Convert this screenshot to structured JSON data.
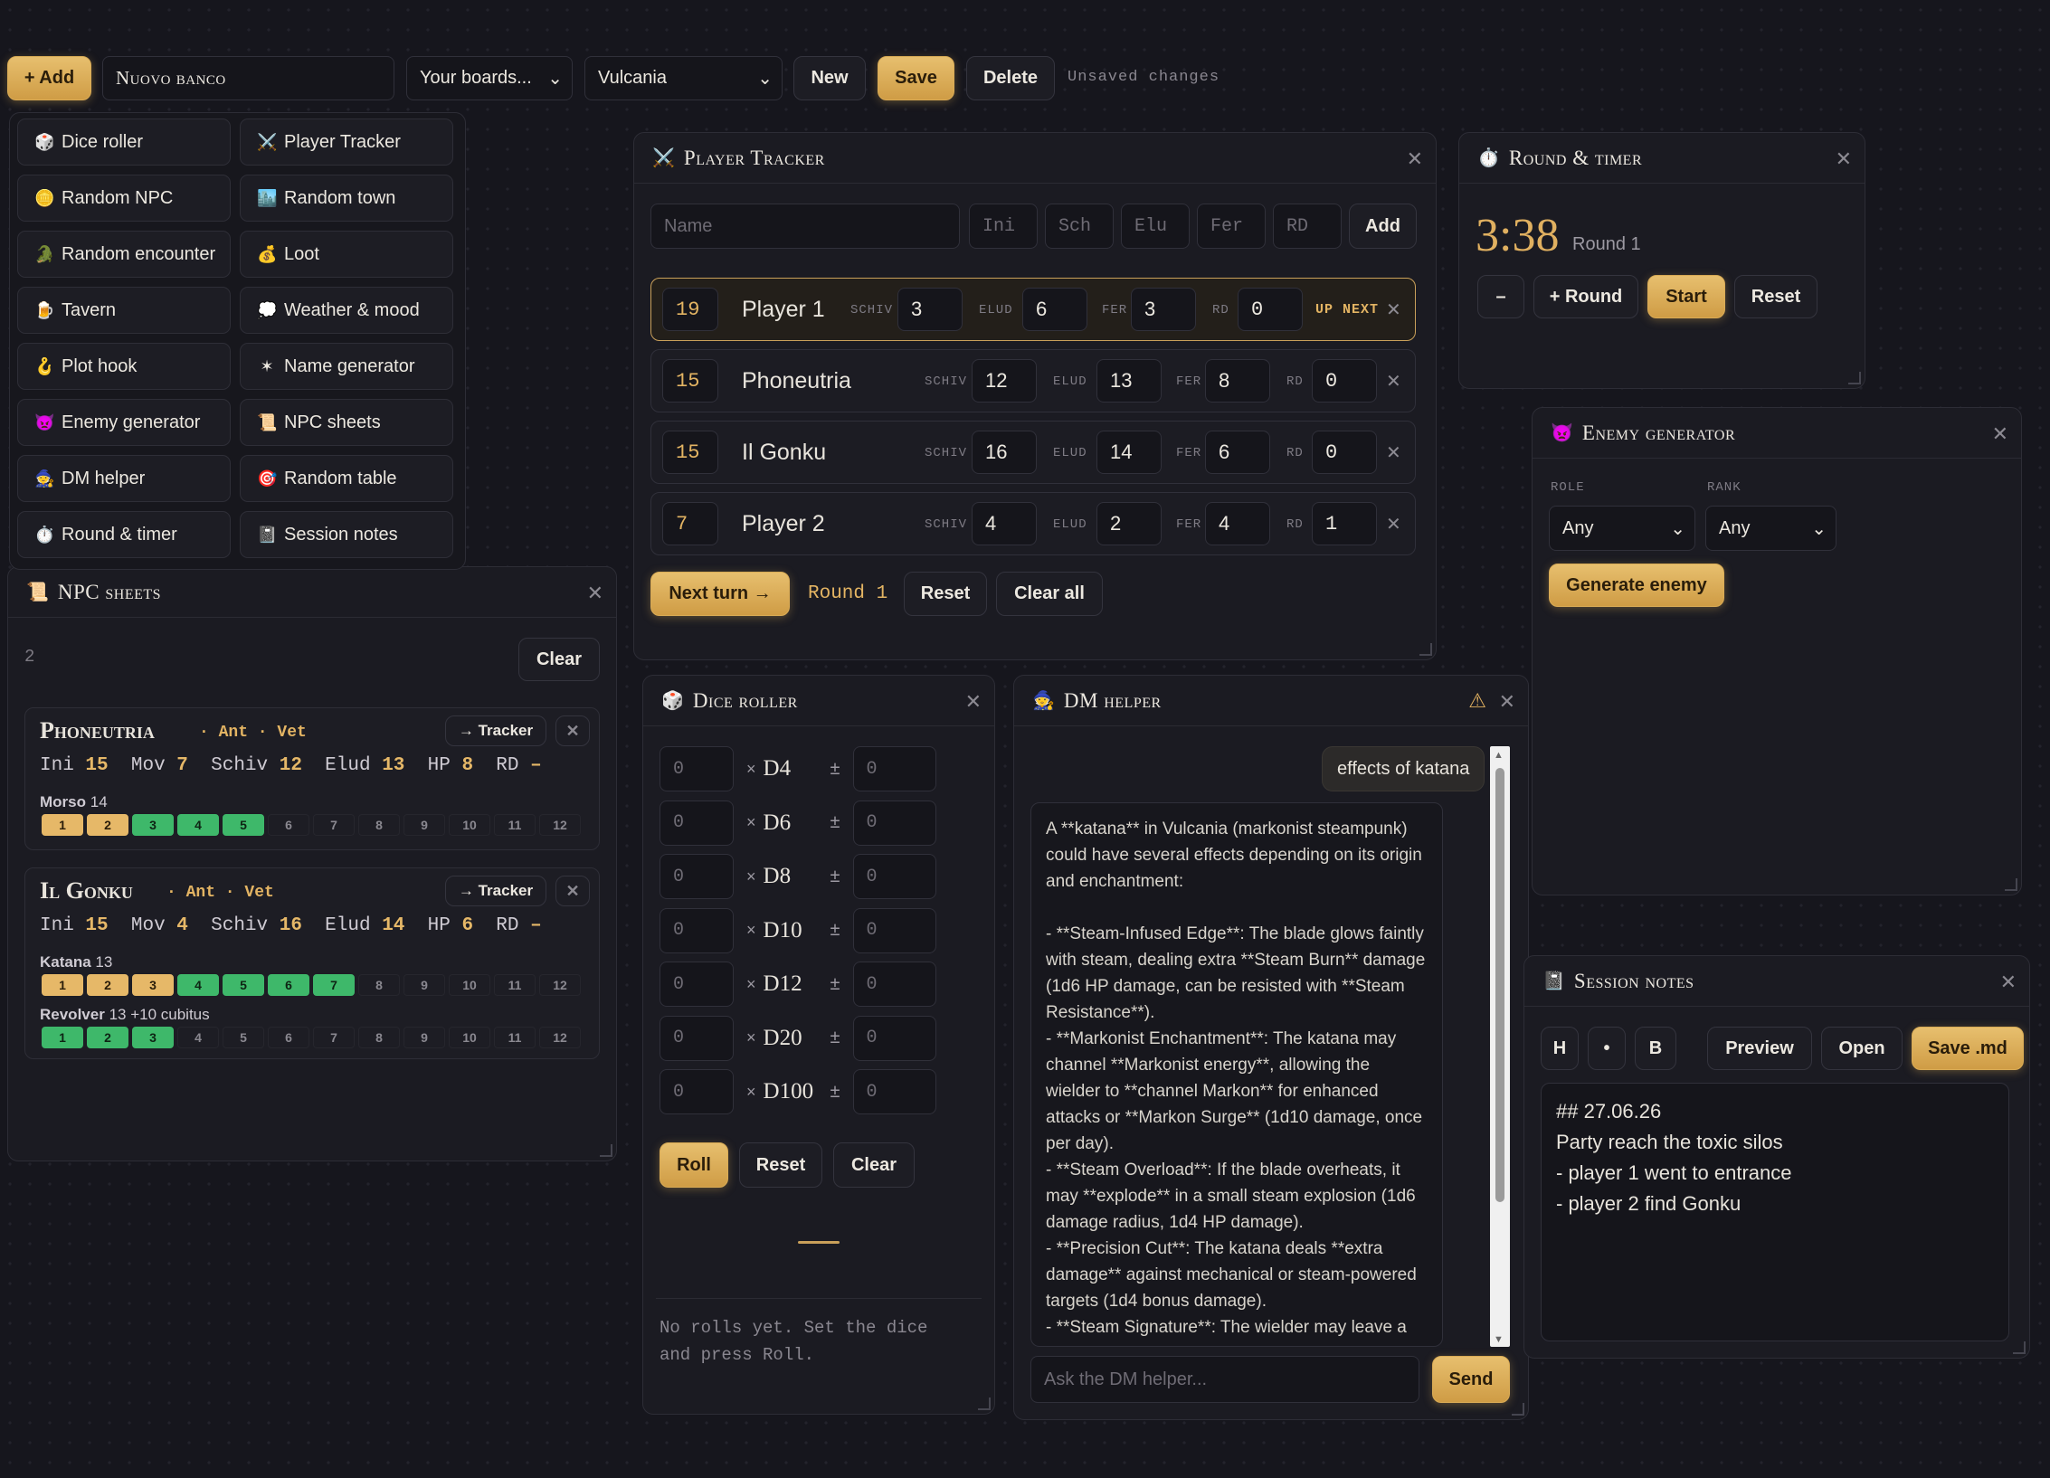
{
  "toolbar": {
    "add_label": "+ Add",
    "board_name": "Nuovo banco",
    "boards_select": "Your boards...",
    "world_select": "Vulcania",
    "new_label": "New",
    "save_label": "Save",
    "delete_label": "Delete",
    "status": "Unsaved changes"
  },
  "add_menu": {
    "items": [
      {
        "icon": "🎲",
        "label": "Dice roller"
      },
      {
        "icon": "⚔️",
        "label": "Player Tracker"
      },
      {
        "icon": "🪙",
        "label": "Random NPC"
      },
      {
        "icon": "🏙️",
        "label": "Random town"
      },
      {
        "icon": "🐊",
        "label": "Random encounter"
      },
      {
        "icon": "💰",
        "label": "Loot"
      },
      {
        "icon": "🍺",
        "label": "Tavern"
      },
      {
        "icon": "💭",
        "label": "Weather & mood"
      },
      {
        "icon": "🪝",
        "label": "Plot hook"
      },
      {
        "icon": "✶",
        "label": "Name generator"
      },
      {
        "icon": "👿",
        "label": "Enemy generator"
      },
      {
        "icon": "📜",
        "label": "NPC sheets"
      },
      {
        "icon": "🧙",
        "label": "DM helper"
      },
      {
        "icon": "🎯",
        "label": "Random table"
      },
      {
        "icon": "⏱️",
        "label": "Round & timer"
      },
      {
        "icon": "📓",
        "label": "Session notes"
      }
    ]
  },
  "player_tracker": {
    "icon": "⚔️",
    "title": "Player Tracker",
    "inputs": {
      "name_placeholder": "Name",
      "ini_placeholder": "Ini",
      "sch_placeholder": "Sch",
      "elu_placeholder": "Elu",
      "fer_placeholder": "Fer",
      "rd_placeholder": "RD"
    },
    "add_label": "Add",
    "stat_labels": {
      "schiv": "SCHIV",
      "elud": "ELUD",
      "fer": "FER",
      "rd": "RD"
    },
    "up_next": "UP NEXT",
    "rows": [
      {
        "ini": "19",
        "name": "Player 1",
        "schiv": "3",
        "elud": "6",
        "fer": "3",
        "rd": "0",
        "active": true
      },
      {
        "ini": "15",
        "name": "Phoneutria",
        "schiv": "12",
        "elud": "13",
        "fer": "8",
        "rd": "0",
        "active": false
      },
      {
        "ini": "15",
        "name": "Il Gonku",
        "schiv": "16",
        "elud": "14",
        "fer": "6",
        "rd": "0",
        "active": false
      },
      {
        "ini": "7",
        "name": "Player 2",
        "schiv": "4",
        "elud": "2",
        "fer": "4",
        "rd": "1",
        "active": false
      }
    ],
    "next_turn_label": "Next turn →",
    "round_text": "Round 1",
    "reset_label": "Reset",
    "clear_all_label": "Clear all"
  },
  "round_timer": {
    "icon": "⏱️",
    "title": "Round & timer",
    "time": "3:38",
    "round": "Round 1",
    "minus_label": "–",
    "plus_round_label": "+ Round",
    "start_label": "Start",
    "reset_label": "Reset"
  },
  "enemy_generator": {
    "icon": "👿",
    "title": "Enemy generator",
    "role_label": "ROLE",
    "rank_label": "RANK",
    "role_value": "Any",
    "rank_value": "Any",
    "generate_label": "Generate enemy"
  },
  "npc_sheets": {
    "icon": "📜",
    "title": "NPC sheets",
    "count": "2",
    "clear_label": "Clear",
    "tracker_label": "→ Tracker",
    "stat_labels": {
      "ini": "Ini",
      "mov": "Mov",
      "schiv": "Schiv",
      "elud": "Elud",
      "hp": "HP",
      "rd": "RD"
    },
    "cards": [
      {
        "name": "Phoneutria",
        "tags": "· Ant · Vet",
        "ini": "15",
        "mov": "7",
        "schiv": "12",
        "elud": "13",
        "hp": "8",
        "rd": "–",
        "tracks": [
          {
            "name": "Morso",
            "value": "14",
            "cells": [
              "y",
              "y",
              "g",
              "g",
              "g",
              "",
              "",
              "",
              "",
              "",
              "",
              ""
            ]
          }
        ]
      },
      {
        "name": "Il Gonku",
        "tags": "· Ant · Vet",
        "ini": "15",
        "mov": "4",
        "schiv": "16",
        "elud": "14",
        "hp": "6",
        "rd": "–",
        "tracks": [
          {
            "name": "Katana",
            "value": "13",
            "cells": [
              "y",
              "y",
              "y",
              "g",
              "g",
              "g",
              "g",
              "",
              "",
              "",
              "",
              ""
            ]
          },
          {
            "name": "Revolver",
            "value": "13 +10 cubitus",
            "cells": [
              "g",
              "g",
              "g",
              "",
              "",
              "",
              "",
              "",
              "",
              "",
              "",
              ""
            ]
          }
        ]
      }
    ]
  },
  "dice_roller": {
    "icon": "🎲",
    "title": "Dice roller",
    "dice": [
      {
        "count": "0",
        "die": "D4",
        "mod": "0"
      },
      {
        "count": "0",
        "die": "D6",
        "mod": "0"
      },
      {
        "count": "0",
        "die": "D8",
        "mod": "0"
      },
      {
        "count": "0",
        "die": "D10",
        "mod": "0"
      },
      {
        "count": "0",
        "die": "D12",
        "mod": "0"
      },
      {
        "count": "0",
        "die": "D20",
        "mod": "0"
      },
      {
        "count": "0",
        "die": "D100",
        "mod": "0"
      }
    ],
    "times": "×",
    "plusminus": "±",
    "roll_label": "Roll",
    "reset_label": "Reset",
    "clear_label": "Clear",
    "empty_text": "No rolls yet. Set the dice and press Roll."
  },
  "dm_helper": {
    "icon": "🧙",
    "title": "DM helper",
    "user_message": "effects of katana",
    "reply": "A **katana** in Vulcania (markonist steampunk) could have several effects depending on its origin and enchantment:\n\n- **Steam-Infused Edge**: The blade glows faintly with steam, dealing extra **Steam Burn** damage (1d6 HP damage, can be resisted with **Steam Resistance**).\n- **Markonist Enchantment**: The katana may channel **Markonist energy**, allowing the wielder to **channel Markon** for enhanced attacks or **Markon Surge** (1d10 damage, once per day).\n- **Steam Overload**: If the blade overheats, it may **explode** in a small steam explosion (1d6 damage radius, 1d4 HP damage).\n- **Precision Cut**: The katana deals **extra damage** against mechanical or steam-powered targets (1d4 bonus damage).\n- **Steam Signature**: The wielder may leave a **steam mark** on surfaces, useful for tracking.",
    "input_placeholder": "Ask the DM helper...",
    "send_label": "Send"
  },
  "session_notes": {
    "icon": "📓",
    "title": "Session notes",
    "h_label": "H",
    "bullet_label": "•",
    "b_label": "B",
    "preview_label": "Preview",
    "open_label": "Open",
    "save_label": "Save .md",
    "content": "## 27.06.26\nParty reach the toxic silos\n- player 1 went to entrance\n- player 2 find Gonku"
  },
  "colors": {
    "accent": "#e0b060",
    "bg": "#16161d",
    "panel": "#1b1b22",
    "green": "#3eb86a"
  }
}
